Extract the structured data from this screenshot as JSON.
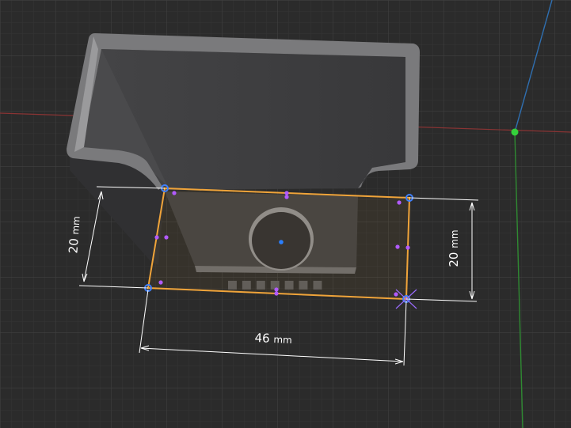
{
  "viewport": {
    "background_color": "#2b2b2b",
    "grid_minor_color": "#353535",
    "grid_major_color": "#3f3f3f",
    "x_axis_color": "#8a3434",
    "y_axis_color": "#2f8a32",
    "z_axis_color": "#2f6fb0",
    "origin_marker_color": "#35d13b"
  },
  "model": {
    "body_color": "#3c3c3e",
    "rim_color": "#8b8b8d",
    "hole_color": "#2e2e31",
    "embossed_text_glyphs": "▪▪▪▪▪▪▪"
  },
  "sketch": {
    "line_color": "#f0a43a",
    "vertex_color": "#3f80ff",
    "midpoint_color": "#b25bff",
    "hole_center_color": "#2a7fff"
  },
  "dimensions": {
    "left_height": "20",
    "right_height": "20",
    "bottom_width": "46",
    "unit": "mm",
    "line_color": "#ffffff"
  }
}
